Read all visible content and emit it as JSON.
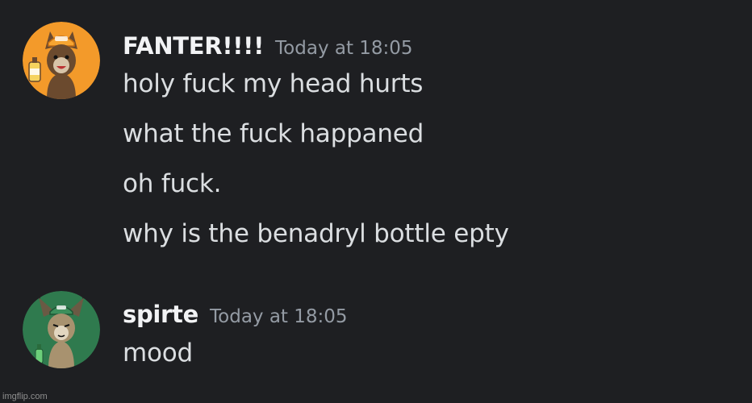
{
  "messages": [
    {
      "username": "FANTER!!!!",
      "timestamp": "Today at 18:05",
      "avatar_icon": "orange-cat-fanta-avatar-icon",
      "avatar_color": "#f39a2a",
      "lines": [
        "holy fuck my head hurts",
        "what the fuck happaned",
        "oh fuck.",
        "why is the benadryl bottle epty"
      ]
    },
    {
      "username": "spirte",
      "timestamp": "Today at 18:05",
      "avatar_icon": "green-cat-sprite-avatar-icon",
      "avatar_color": "#2f7a4e",
      "lines": [
        "mood"
      ]
    }
  ],
  "watermark": "imgflip.com",
  "colors": {
    "background": "#1e1f22",
    "username": "#f2f3f5",
    "timestamp": "#949ba4",
    "message_text": "#dbdee1"
  }
}
